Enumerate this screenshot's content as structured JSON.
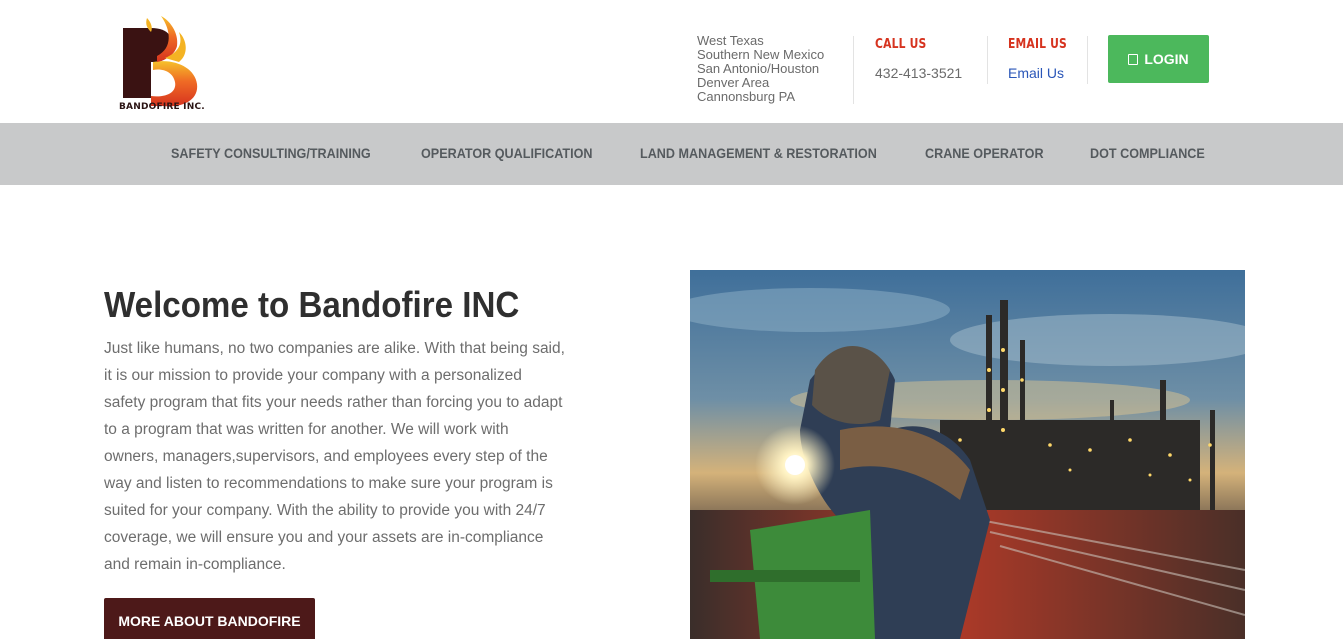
{
  "brand": {
    "logo_text": "BANDOFIRE INC.",
    "colors": {
      "maroon": "#4d1919",
      "flame_red": "#d6331f",
      "flame_yellow": "#f4b323",
      "green": "#4cb85c",
      "nav_bg": "#c8c9ca"
    }
  },
  "header": {
    "locations": [
      "West Texas",
      "Southern New Mexico",
      "San Antonio/Houston",
      "Denver Area",
      "Cannonsburg PA"
    ],
    "call": {
      "label": "CALL US",
      "value": "432-413-3521"
    },
    "email": {
      "label": "EMAIL US",
      "value": "Email Us"
    },
    "login": {
      "icon": "login-icon",
      "label": "LOGIN"
    }
  },
  "nav": {
    "items": [
      {
        "label": "SAFETY CONSULTING/TRAINING"
      },
      {
        "label": "OPERATOR QUALIFICATION"
      },
      {
        "label": "LAND MANAGEMENT & RESTORATION"
      },
      {
        "label": "CRANE OPERATOR"
      },
      {
        "label": "DOT COMPLIANCE"
      }
    ]
  },
  "main": {
    "title": "Welcome to Bandofire INC",
    "body": "Just like humans, no two companies are alike. With that being said, it is our mission to provide your company with a personalized safety program that fits your needs rather than forcing you to adapt to a program that was written for another. We will work with owners, managers,supervisors, and employees every step of the way and listen to recommendations to make sure your program is suited for your company. With the ability to provide you with 24/7 coverage, we will ensure you and your assets are in-compliance and remain in-compliance.",
    "button": "MORE ABOUT BANDOFIRE"
  }
}
